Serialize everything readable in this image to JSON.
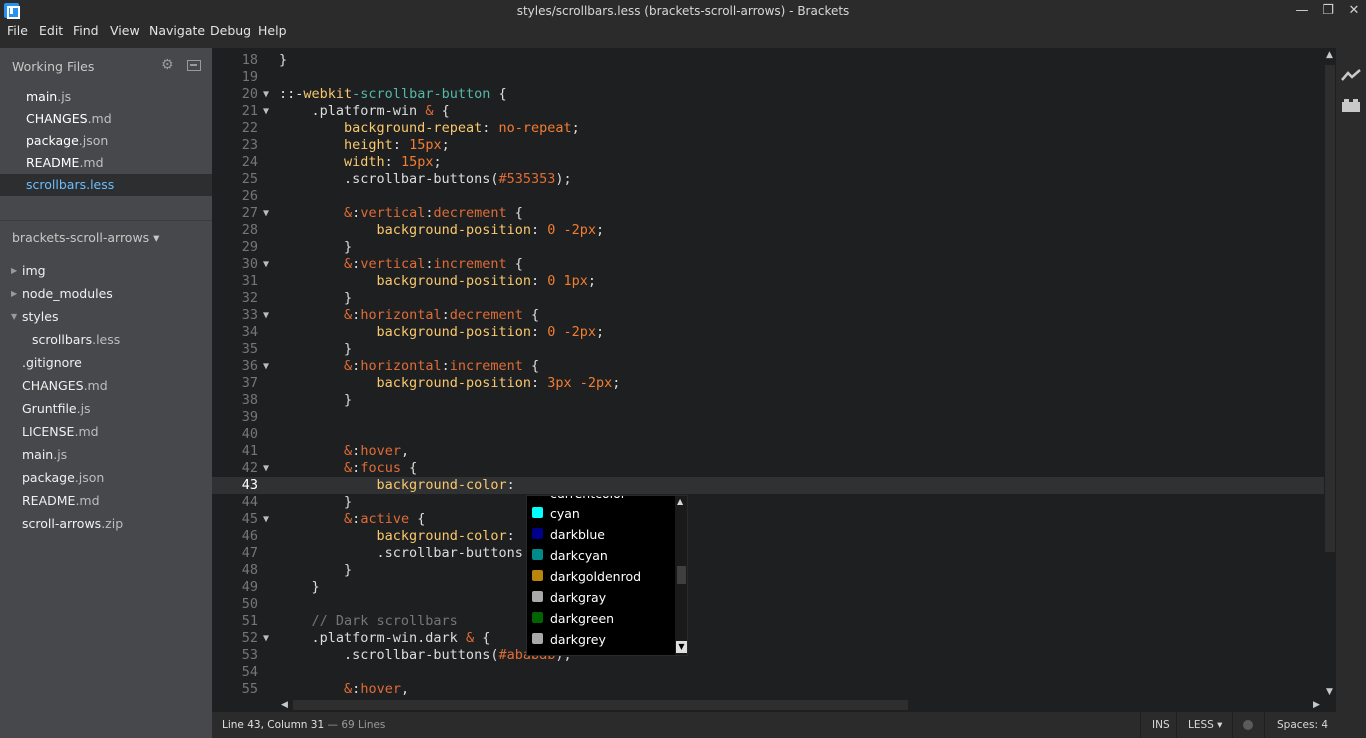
{
  "window": {
    "title": "styles/scrollbars.less (brackets-scroll-arrows) - Brackets",
    "minimize": "—",
    "restore": "❐",
    "close": "✕"
  },
  "menu": [
    "File",
    "Edit",
    "Find",
    "View",
    "Navigate",
    "Debug",
    "Help"
  ],
  "sidebar": {
    "working_files_title": "Working Files",
    "working_files": [
      {
        "name": "main",
        "ext": ".js"
      },
      {
        "name": "CHANGES",
        "ext": ".md"
      },
      {
        "name": "package",
        "ext": ".json"
      },
      {
        "name": "README",
        "ext": ".md"
      },
      {
        "name": "scrollbars",
        "ext": ".less",
        "active": true
      }
    ],
    "project_title": "brackets-scroll-arrows ▾",
    "tree": [
      {
        "name": "img",
        "ext": "",
        "type": "folder",
        "open": false
      },
      {
        "name": "node_modules",
        "ext": "",
        "type": "folder",
        "open": false
      },
      {
        "name": "styles",
        "ext": "",
        "type": "folder",
        "open": true
      },
      {
        "name": "scrollbars",
        "ext": ".less",
        "type": "file",
        "child": true
      },
      {
        "name": ".gitignore",
        "ext": "",
        "type": "file"
      },
      {
        "name": "CHANGES",
        "ext": ".md",
        "type": "file"
      },
      {
        "name": "Gruntfile",
        "ext": ".js",
        "type": "file"
      },
      {
        "name": "LICENSE",
        "ext": ".md",
        "type": "file"
      },
      {
        "name": "main",
        "ext": ".js",
        "type": "file"
      },
      {
        "name": "package",
        "ext": ".json",
        "type": "file"
      },
      {
        "name": "README",
        "ext": ".md",
        "type": "file"
      },
      {
        "name": "scroll-arrows",
        "ext": ".zip",
        "type": "file"
      }
    ]
  },
  "editor": {
    "current_line": 43,
    "lines": [
      {
        "n": "18",
        "fold": "",
        "tokens": [
          [
            "p",
            "}"
          ]
        ]
      },
      {
        "n": "19",
        "fold": "",
        "tokens": []
      },
      {
        "n": "20",
        "fold": "▼",
        "tokens": [
          [
            "p",
            "::-"
          ],
          [
            "s",
            "webkit"
          ],
          [
            "t",
            "-scrollbar-button"
          ],
          [
            "p",
            " {"
          ]
        ]
      },
      {
        "n": "21",
        "fold": "▼",
        "tokens": [
          [
            "p",
            "    .platform-win "
          ],
          [
            "n",
            "&"
          ],
          [
            "p",
            " {"
          ]
        ]
      },
      {
        "n": "22",
        "fold": "",
        "tokens": [
          [
            "p",
            "        "
          ],
          [
            "s",
            "background-repeat"
          ],
          [
            "p",
            ": "
          ],
          [
            "v",
            "no-repeat"
          ],
          [
            "p",
            ";"
          ]
        ]
      },
      {
        "n": "23",
        "fold": "",
        "tokens": [
          [
            "p",
            "        "
          ],
          [
            "s",
            "height"
          ],
          [
            "p",
            ": "
          ],
          [
            "v",
            "15px"
          ],
          [
            "p",
            ";"
          ]
        ]
      },
      {
        "n": "24",
        "fold": "",
        "tokens": [
          [
            "p",
            "        "
          ],
          [
            "s",
            "width"
          ],
          [
            "p",
            ": "
          ],
          [
            "v",
            "15px"
          ],
          [
            "p",
            ";"
          ]
        ]
      },
      {
        "n": "25",
        "fold": "",
        "tokens": [
          [
            "p",
            "        .scrollbar-buttons("
          ],
          [
            "n",
            "#535353"
          ],
          [
            "p",
            ");"
          ]
        ]
      },
      {
        "n": "26",
        "fold": "",
        "tokens": []
      },
      {
        "n": "27",
        "fold": "▼",
        "tokens": [
          [
            "p",
            "        "
          ],
          [
            "n",
            "&"
          ],
          [
            "p",
            ":"
          ],
          [
            "n",
            "vertical"
          ],
          [
            "p",
            ":"
          ],
          [
            "n",
            "decrement"
          ],
          [
            "p",
            " {"
          ]
        ]
      },
      {
        "n": "28",
        "fold": "",
        "tokens": [
          [
            "p",
            "            "
          ],
          [
            "s",
            "background-position"
          ],
          [
            "p",
            ": "
          ],
          [
            "v",
            "0 -2px"
          ],
          [
            "p",
            ";"
          ]
        ]
      },
      {
        "n": "29",
        "fold": "",
        "tokens": [
          [
            "p",
            "        }"
          ]
        ]
      },
      {
        "n": "30",
        "fold": "▼",
        "tokens": [
          [
            "p",
            "        "
          ],
          [
            "n",
            "&"
          ],
          [
            "p",
            ":"
          ],
          [
            "n",
            "vertical"
          ],
          [
            "p",
            ":"
          ],
          [
            "n",
            "increment"
          ],
          [
            "p",
            " {"
          ]
        ]
      },
      {
        "n": "31",
        "fold": "",
        "tokens": [
          [
            "p",
            "            "
          ],
          [
            "s",
            "background-position"
          ],
          [
            "p",
            ": "
          ],
          [
            "v",
            "0 1px"
          ],
          [
            "p",
            ";"
          ]
        ]
      },
      {
        "n": "32",
        "fold": "",
        "tokens": [
          [
            "p",
            "        }"
          ]
        ]
      },
      {
        "n": "33",
        "fold": "▼",
        "tokens": [
          [
            "p",
            "        "
          ],
          [
            "n",
            "&"
          ],
          [
            "p",
            ":"
          ],
          [
            "n",
            "horizontal"
          ],
          [
            "p",
            ":"
          ],
          [
            "n",
            "decrement"
          ],
          [
            "p",
            " {"
          ]
        ]
      },
      {
        "n": "34",
        "fold": "",
        "tokens": [
          [
            "p",
            "            "
          ],
          [
            "s",
            "background-position"
          ],
          [
            "p",
            ": "
          ],
          [
            "v",
            "0 -2px"
          ],
          [
            "p",
            ";"
          ]
        ]
      },
      {
        "n": "35",
        "fold": "",
        "tokens": [
          [
            "p",
            "        }"
          ]
        ]
      },
      {
        "n": "36",
        "fold": "▼",
        "tokens": [
          [
            "p",
            "        "
          ],
          [
            "n",
            "&"
          ],
          [
            "p",
            ":"
          ],
          [
            "n",
            "horizontal"
          ],
          [
            "p",
            ":"
          ],
          [
            "n",
            "increment"
          ],
          [
            "p",
            " {"
          ]
        ]
      },
      {
        "n": "37",
        "fold": "",
        "tokens": [
          [
            "p",
            "            "
          ],
          [
            "s",
            "background-position"
          ],
          [
            "p",
            ": "
          ],
          [
            "v",
            "3px -2px"
          ],
          [
            "p",
            ";"
          ]
        ]
      },
      {
        "n": "38",
        "fold": "",
        "tokens": [
          [
            "p",
            "        }"
          ]
        ]
      },
      {
        "n": "39",
        "fold": "",
        "tokens": []
      },
      {
        "n": "40",
        "fold": "",
        "tokens": []
      },
      {
        "n": "41",
        "fold": "",
        "tokens": [
          [
            "p",
            "        "
          ],
          [
            "n",
            "&"
          ],
          [
            "p",
            ":"
          ],
          [
            "n",
            "hover"
          ],
          [
            "p",
            ","
          ]
        ]
      },
      {
        "n": "42",
        "fold": "▼",
        "tokens": [
          [
            "p",
            "        "
          ],
          [
            "n",
            "&"
          ],
          [
            "p",
            ":"
          ],
          [
            "n",
            "focus"
          ],
          [
            "p",
            " {"
          ]
        ]
      },
      {
        "n": "43",
        "fold": "",
        "tokens": [
          [
            "p",
            "            "
          ],
          [
            "s",
            "background-color"
          ],
          [
            "p",
            ":"
          ]
        ]
      },
      {
        "n": "44",
        "fold": "",
        "tokens": [
          [
            "p",
            "        }"
          ]
        ]
      },
      {
        "n": "45",
        "fold": "▼",
        "tokens": [
          [
            "p",
            "        "
          ],
          [
            "n",
            "&"
          ],
          [
            "p",
            ":"
          ],
          [
            "n",
            "active"
          ],
          [
            "p",
            " {"
          ]
        ]
      },
      {
        "n": "46",
        "fold": "",
        "tokens": [
          [
            "p",
            "            "
          ],
          [
            "s",
            "background-color"
          ],
          [
            "p",
            ":"
          ]
        ]
      },
      {
        "n": "47",
        "fold": "",
        "tokens": [
          [
            "p",
            "            .scrollbar-buttons"
          ]
        ]
      },
      {
        "n": "48",
        "fold": "",
        "tokens": [
          [
            "p",
            "        }"
          ]
        ]
      },
      {
        "n": "49",
        "fold": "",
        "tokens": [
          [
            "p",
            "    }"
          ]
        ]
      },
      {
        "n": "50",
        "fold": "",
        "tokens": []
      },
      {
        "n": "51",
        "fold": "",
        "tokens": [
          [
            "p",
            "    "
          ],
          [
            "c",
            "// Dark scrollbars"
          ]
        ]
      },
      {
        "n": "52",
        "fold": "▼",
        "tokens": [
          [
            "p",
            "    .platform-win.dark "
          ],
          [
            "n",
            "&"
          ],
          [
            "p",
            " {"
          ]
        ]
      },
      {
        "n": "53",
        "fold": "",
        "tokens": [
          [
            "p",
            "        .scrollbar-buttons("
          ],
          [
            "n",
            "#ababab"
          ],
          [
            "p",
            ");"
          ]
        ]
      },
      {
        "n": "54",
        "fold": "",
        "tokens": []
      },
      {
        "n": "55",
        "fold": "",
        "tokens": [
          [
            "p",
            "        "
          ],
          [
            "n",
            "&"
          ],
          [
            "p",
            ":"
          ],
          [
            "n",
            "hover"
          ],
          [
            "p",
            ","
          ]
        ]
      }
    ]
  },
  "hints": {
    "partial_above": "currentcolor",
    "items": [
      {
        "label": "cyan",
        "color": "#00ffff"
      },
      {
        "label": "darkblue",
        "color": "#00008b"
      },
      {
        "label": "darkcyan",
        "color": "#008b8b"
      },
      {
        "label": "darkgoldenrod",
        "color": "#b8860b"
      },
      {
        "label": "darkgray",
        "color": "#a9a9a9"
      },
      {
        "label": "darkgreen",
        "color": "#006400"
      },
      {
        "label": "darkgrey",
        "color": "#a9a9a9"
      }
    ],
    "up_arrow": "▲",
    "down_arrow": "▼"
  },
  "status": {
    "cursor": "Line 43, Column 31",
    "lines": " — 69 Lines",
    "mode": "INS",
    "language": "LESS ▾",
    "spaces": "Spaces: 4"
  },
  "scroll": {
    "up": "▲",
    "down": "▼",
    "left": "◀",
    "right": "▶"
  }
}
